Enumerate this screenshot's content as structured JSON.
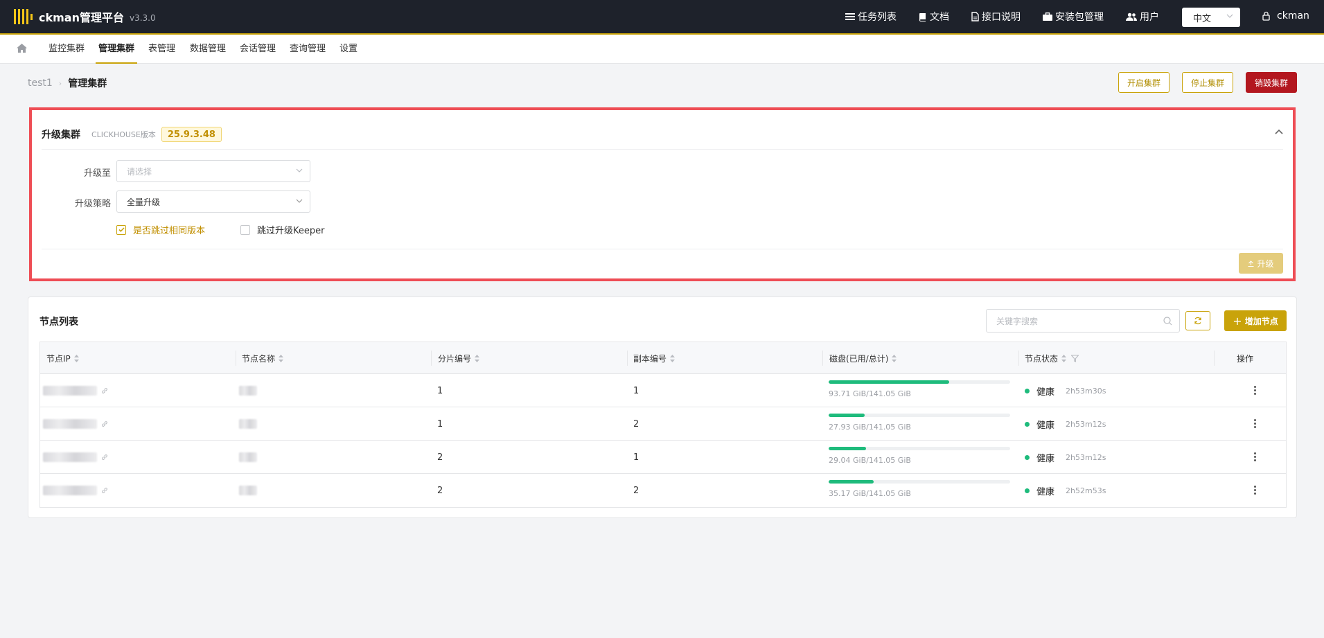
{
  "brand": {
    "title": "ckman管理平台",
    "version": "v3.3.0"
  },
  "topnav": [
    {
      "label": "任务列表",
      "icon": "list-icon"
    },
    {
      "label": "文档",
      "icon": "book-icon"
    },
    {
      "label": "接口说明",
      "icon": "file-icon"
    },
    {
      "label": "安装包管理",
      "icon": "briefcase-icon"
    },
    {
      "label": "用户",
      "icon": "users-icon"
    }
  ],
  "language": {
    "selected": "中文"
  },
  "user": {
    "name": "ckman"
  },
  "subnav": {
    "tabs": [
      "监控集群",
      "管理集群",
      "表管理",
      "数据管理",
      "会话管理",
      "查询管理",
      "设置"
    ],
    "active": "管理集群"
  },
  "breadcrumb": {
    "cluster": "test1",
    "page": "管理集群"
  },
  "actions": {
    "start": "开启集群",
    "stop": "停止集群",
    "destroy": "销毁集群"
  },
  "upgrade": {
    "title": "升级集群",
    "version_label": "CLICKHOUSE版本",
    "version": "25.9.3.48",
    "target_label": "升级至",
    "target_placeholder": "请选择",
    "policy_label": "升级策略",
    "policy_value": "全量升级",
    "skip_same": {
      "label": "是否跳过相同版本",
      "checked": true
    },
    "skip_keeper": {
      "label": "跳过升级Keeper",
      "checked": false
    },
    "button": "升级"
  },
  "nodes": {
    "title": "节点列表",
    "search_placeholder": "关键字搜索",
    "add_button": "增加节点",
    "columns": [
      "节点IP",
      "节点名称",
      "分片编号",
      "副本编号",
      "磁盘(已用/总计)",
      "节点状态",
      "操作"
    ],
    "rows": [
      {
        "shard": "1",
        "replica": "1",
        "disk_text": "93.71 GiB/141.05 GiB",
        "disk_used_pct": 66.4,
        "status": "健康",
        "uptime": "2h53m30s"
      },
      {
        "shard": "1",
        "replica": "2",
        "disk_text": "27.93 GiB/141.05 GiB",
        "disk_used_pct": 19.8,
        "status": "健康",
        "uptime": "2h53m12s"
      },
      {
        "shard": "2",
        "replica": "1",
        "disk_text": "29.04 GiB/141.05 GiB",
        "disk_used_pct": 20.6,
        "status": "健康",
        "uptime": "2h53m12s"
      },
      {
        "shard": "2",
        "replica": "2",
        "disk_text": "35.17 GiB/141.05 GiB",
        "disk_used_pct": 24.9,
        "status": "健康",
        "uptime": "2h52m53s"
      }
    ]
  },
  "colors": {
    "accent": "#c9a30a",
    "danger": "#b3171f",
    "healthy": "#1ebb7c",
    "topbar": "#1e222b",
    "highlight_border": "#ee4d55"
  }
}
